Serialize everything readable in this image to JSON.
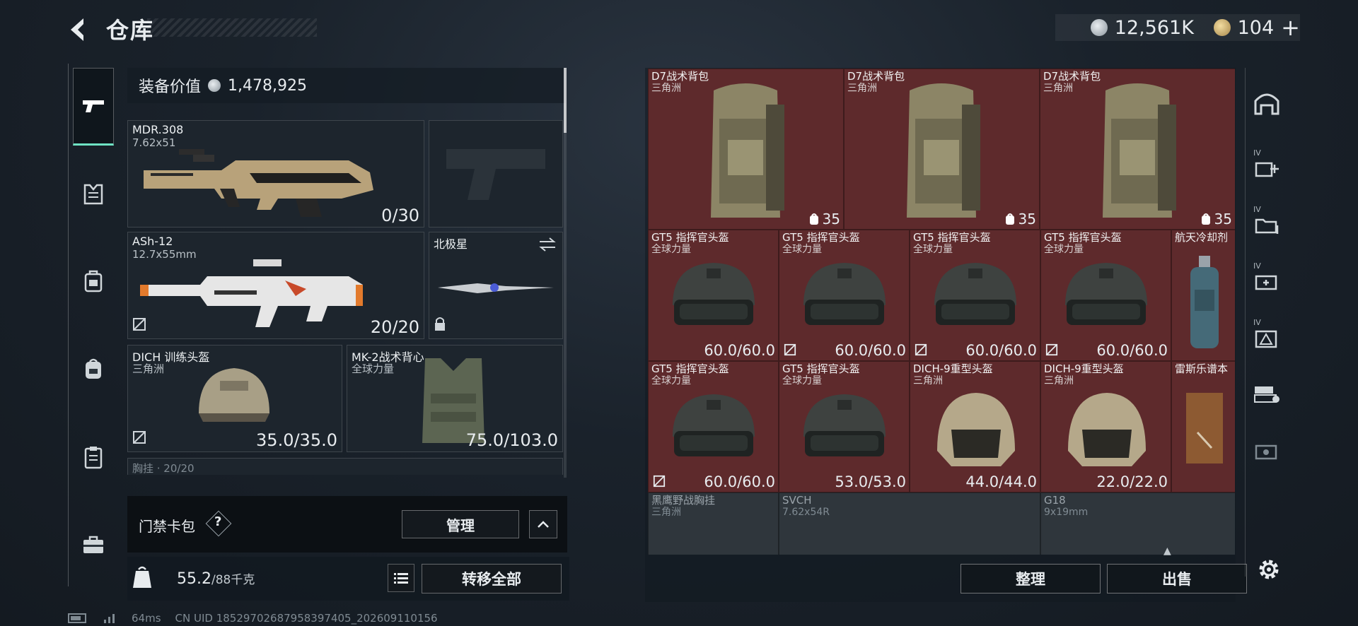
{
  "header": {
    "title": "仓库"
  },
  "currency": {
    "coins": "12,561K",
    "premium": "104"
  },
  "left_tabs": [
    "weapons-tab",
    "armor-tab",
    "chest-rig-tab",
    "backpack-tab",
    "clipboard-tab",
    "toolbox-tab"
  ],
  "equipment": {
    "value_label": "装备价值",
    "value": "1,478,925",
    "slots": {
      "primary": {
        "name": "MDR.308",
        "ammo": "7.62x51",
        "count": "0/30"
      },
      "pistol": {
        "name": "",
        "ammo": "",
        "count": ""
      },
      "secondary": {
        "name": "ASh-12",
        "ammo": "12.7x55mm",
        "count": "20/20"
      },
      "melee": {
        "name": "北极星"
      },
      "helmet": {
        "name": "DICH 训练头盔",
        "sub": "三角洲",
        "durability": "35.0/35.0"
      },
      "armor": {
        "name": "MK-2战术背心",
        "sub": "全球力量",
        "durability": "75.0/103.0"
      },
      "rig_partial": "胸挂 · 20/20"
    }
  },
  "access": {
    "label": "门禁卡包",
    "help": "?",
    "manage": "管理"
  },
  "weight": {
    "current": "55.2",
    "max": "/88千克"
  },
  "transfer_all": "转移全部",
  "grid": {
    "cells": [
      {
        "name": "D7战术背包",
        "sub": "三角洲",
        "capacity": "35"
      },
      {
        "name": "D7战术背包",
        "sub": "三角洲",
        "capacity": "35"
      },
      {
        "name": "D7战术背包",
        "sub": "三角洲",
        "capacity": "35"
      },
      {
        "name": "GT5 指挥官头盔",
        "sub": "全球力量",
        "value": "60.0/60.0"
      },
      {
        "name": "GT5 指挥官头盔",
        "sub": "全球力量",
        "value": "60.0/60.0"
      },
      {
        "name": "GT5 指挥官头盔",
        "sub": "全球力量",
        "value": "60.0/60.0"
      },
      {
        "name": "GT5 指挥官头盔",
        "sub": "全球力量",
        "value": "60.0/60.0"
      },
      {
        "name": "航天冷却剂",
        "sub": ""
      },
      {
        "name": "GT5 指挥官头盔",
        "sub": "全球力量",
        "value": "60.0/60.0"
      },
      {
        "name": "GT5 指挥官头盔",
        "sub": "全球力量",
        "value": "53.0/53.0"
      },
      {
        "name": "DICH-9重型头盔",
        "sub": "三角洲",
        "value": "44.0/44.0"
      },
      {
        "name": "DICH-9重型头盔",
        "sub": "三角洲",
        "value": "22.0/22.0"
      },
      {
        "name": "雷斯乐谱本",
        "sub": ""
      },
      {
        "name": "黑鹰野战胸挂",
        "sub": "三角洲"
      },
      {
        "name": "SVCH",
        "sub": "7.62x54R"
      },
      {
        "name": "G18",
        "sub": "9x19mm"
      }
    ]
  },
  "actions": {
    "sort": "整理",
    "sell": "出售"
  },
  "right_tabs": [
    "IV",
    "IV",
    "IV",
    "IV"
  ],
  "status": {
    "ping": "64ms",
    "uid": "CN UID 18529702687958397405_202609110156"
  },
  "colors": {
    "accent": "#6fe3c4",
    "cell_bg": "#5e2a2c"
  }
}
